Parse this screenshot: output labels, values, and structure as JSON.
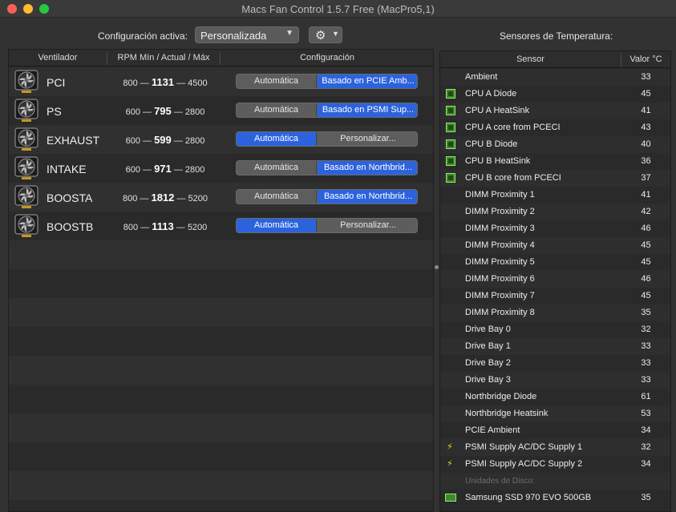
{
  "window": {
    "title": "Macs Fan Control 1.5.7 Free (MacPro5,1)"
  },
  "toolbar": {
    "config_label": "Configuración activa:",
    "preset_value": "Personalizada",
    "sensors_label": "Sensores de Temperatura:"
  },
  "fans_table": {
    "headers": {
      "fan": "Ventilador",
      "rpm": "RPM Mín / Actual / Máx",
      "config": "Configuración"
    },
    "dash": "—",
    "rows": [
      {
        "name": "PCI",
        "min": "800",
        "current": "1131",
        "max": "4500",
        "auto_label": "Automática",
        "custom_label": "Basado en PCIE Amb...",
        "selected": "custom"
      },
      {
        "name": "PS",
        "min": "600",
        "current": "795",
        "max": "2800",
        "auto_label": "Automática",
        "custom_label": "Basado en PSMI Sup...",
        "selected": "custom"
      },
      {
        "name": "EXHAUST",
        "min": "600",
        "current": "599",
        "max": "2800",
        "auto_label": "Automática",
        "custom_label": "Personalizar...",
        "selected": "auto"
      },
      {
        "name": "INTAKE",
        "min": "600",
        "current": "971",
        "max": "2800",
        "auto_label": "Automática",
        "custom_label": "Basado en Northbrid...",
        "selected": "custom"
      },
      {
        "name": "BOOSTA",
        "min": "800",
        "current": "1812",
        "max": "5200",
        "auto_label": "Automática",
        "custom_label": "Basado en Northbrid...",
        "selected": "custom"
      },
      {
        "name": "BOOSTB",
        "min": "800",
        "current": "1113",
        "max": "5200",
        "auto_label": "Automática",
        "custom_label": "Personalizar...",
        "selected": "auto"
      }
    ]
  },
  "sensors_table": {
    "headers": {
      "sensor": "Sensor",
      "value": "Valor °C"
    },
    "rows": [
      {
        "name": "Ambient",
        "value": "33",
        "icon": "none"
      },
      {
        "name": "CPU A Diode",
        "value": "45",
        "icon": "chip-icon"
      },
      {
        "name": "CPU A HeatSink",
        "value": "41",
        "icon": "chip-icon"
      },
      {
        "name": "CPU A core from PCECI",
        "value": "43",
        "icon": "chip-icon"
      },
      {
        "name": "CPU B Diode",
        "value": "40",
        "icon": "chip-icon"
      },
      {
        "name": "CPU B HeatSink",
        "value": "36",
        "icon": "chip-icon"
      },
      {
        "name": "CPU B core from PCECI",
        "value": "37",
        "icon": "chip-icon"
      },
      {
        "name": "DIMM Proximity 1",
        "value": "41",
        "icon": "none"
      },
      {
        "name": "DIMM Proximity 2",
        "value": "42",
        "icon": "none"
      },
      {
        "name": "DIMM Proximity 3",
        "value": "46",
        "icon": "none"
      },
      {
        "name": "DIMM Proximity 4",
        "value": "45",
        "icon": "none"
      },
      {
        "name": "DIMM Proximity 5",
        "value": "45",
        "icon": "none"
      },
      {
        "name": "DIMM Proximity 6",
        "value": "46",
        "icon": "none"
      },
      {
        "name": "DIMM Proximity 7",
        "value": "45",
        "icon": "none"
      },
      {
        "name": "DIMM Proximity 8",
        "value": "35",
        "icon": "none"
      },
      {
        "name": "Drive Bay 0",
        "value": "32",
        "icon": "none"
      },
      {
        "name": "Drive Bay 1",
        "value": "33",
        "icon": "none"
      },
      {
        "name": "Drive Bay 2",
        "value": "33",
        "icon": "none"
      },
      {
        "name": "Drive Bay 3",
        "value": "33",
        "icon": "none"
      },
      {
        "name": "Northbridge Diode",
        "value": "61",
        "icon": "none"
      },
      {
        "name": "Northbridge Heatsink",
        "value": "53",
        "icon": "none"
      },
      {
        "name": "PCIE Ambient",
        "value": "34",
        "icon": "none"
      },
      {
        "name": "PSMI Supply AC/DC Supply 1",
        "value": "32",
        "icon": "bolt-icon"
      },
      {
        "name": "PSMI Supply AC/DC Supply 2",
        "value": "34",
        "icon": "bolt-icon"
      }
    ],
    "disks_section_label": "Unidades de Disco:",
    "disks": [
      {
        "name": "Samsung SSD 970 EVO 500GB",
        "value": "35",
        "icon": "ssd-icon"
      }
    ]
  },
  "colors": {
    "accent": "#2c63dd",
    "window_bg": "#323232",
    "chip_green": "#3b8a2a",
    "bolt_yellow": "#f2d21e"
  }
}
